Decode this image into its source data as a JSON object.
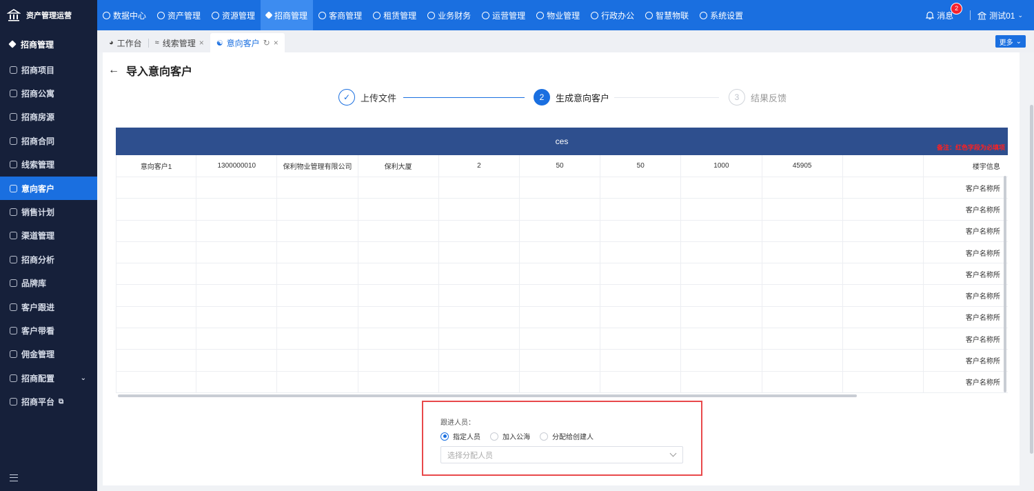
{
  "brand": {
    "title": "资产管理运营"
  },
  "nav": [
    {
      "label": "数据中心",
      "icon": "clock-icon"
    },
    {
      "label": "资产管理",
      "icon": "cube-icon"
    },
    {
      "label": "资源管理",
      "icon": "building-icon"
    },
    {
      "label": "招商管理",
      "icon": "tag-icon",
      "active": true
    },
    {
      "label": "客商管理",
      "icon": "users-icon"
    },
    {
      "label": "租赁管理",
      "icon": "house-icon"
    },
    {
      "label": "业务财务",
      "icon": "coin-icon"
    },
    {
      "label": "运营管理",
      "icon": "chart-icon"
    },
    {
      "label": "物业管理",
      "icon": "home-icon"
    },
    {
      "label": "行政办公",
      "icon": "monitor-icon"
    },
    {
      "label": "智慧物联",
      "icon": "atom-icon"
    },
    {
      "label": "系统设置",
      "icon": "gear-icon"
    }
  ],
  "header": {
    "messages_label": "消息",
    "messages_count": "2",
    "user_name": "测试01"
  },
  "sidebar": {
    "title": "招商管理",
    "items": [
      {
        "label": "招商项目"
      },
      {
        "label": "招商公寓"
      },
      {
        "label": "招商房源"
      },
      {
        "label": "招商合同"
      },
      {
        "label": "线索管理"
      },
      {
        "label": "意向客户",
        "active": true
      },
      {
        "label": "销售计划"
      },
      {
        "label": "渠道管理"
      },
      {
        "label": "招商分析"
      },
      {
        "label": "品牌库"
      },
      {
        "label": "客户跟进"
      },
      {
        "label": "客户带看"
      },
      {
        "label": "佣金管理"
      },
      {
        "label": "招商配置"
      },
      {
        "label": "招商平台"
      }
    ]
  },
  "tabs": [
    {
      "label": "工作台"
    },
    {
      "label": "线索管理"
    },
    {
      "label": "意向客户",
      "active": true
    }
  ],
  "more_label": "更多",
  "page": {
    "title": "导入意向客户"
  },
  "steps": [
    {
      "num": "1",
      "label": "上传文件",
      "status": "done"
    },
    {
      "num": "2",
      "label": "生成意向客户",
      "status": "active"
    },
    {
      "num": "3",
      "label": "结果反馈",
      "status": "pending"
    }
  ],
  "table": {
    "header": "ces",
    "note": "备注：红色字段为必填项",
    "first_row": [
      "意向客户1",
      "1300000010",
      "保利物业管理有限公司",
      "保利大厦",
      "2",
      "50",
      "50",
      "1000",
      "45905",
      "",
      "楼宇信息"
    ],
    "empty_rows_last": [
      "客户名称所",
      "客户名称所",
      "客户名称所",
      "客户名称所",
      "客户名称所",
      "客户名称所",
      "客户名称所",
      "客户名称所",
      "客户名称所",
      "客户名称所"
    ]
  },
  "form": {
    "label": "跟进人员：",
    "options": [
      "指定人员",
      "加入公海",
      "分配给创建人"
    ],
    "selected": "指定人员",
    "select_placeholder": "选择分配人员"
  }
}
